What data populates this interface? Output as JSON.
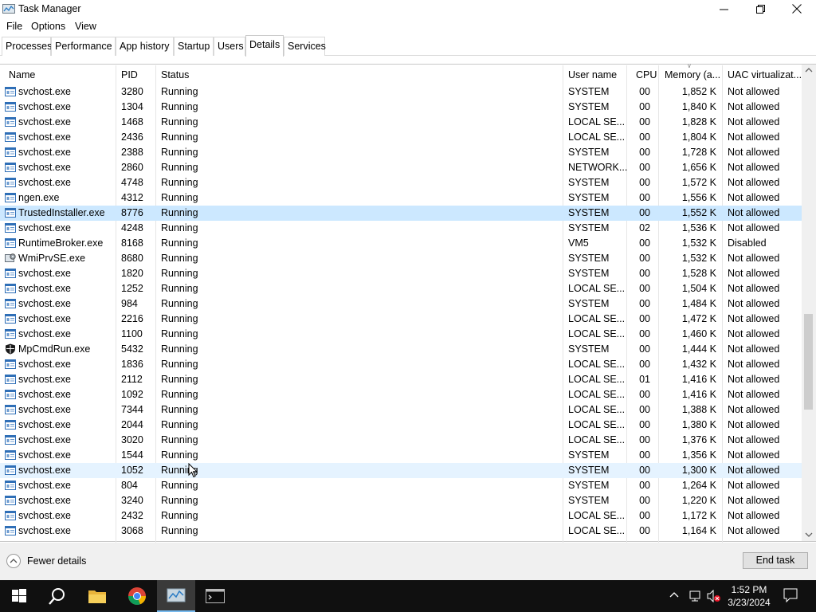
{
  "window": {
    "title": "Task Manager"
  },
  "menu": [
    "File",
    "Options",
    "View"
  ],
  "tabs": [
    "Processes",
    "Performance",
    "App history",
    "Startup",
    "Users",
    "Details",
    "Services"
  ],
  "active_tab": "Details",
  "columns": {
    "name": "Name",
    "pid": "PID",
    "status": "Status",
    "user": "User name",
    "cpu": "CPU",
    "memory": "Memory (a...",
    "uac": "UAC virtualizat..."
  },
  "processes": [
    {
      "name": "svchost.exe",
      "pid": "3280",
      "status": "Running",
      "user": "SYSTEM",
      "cpu": "00",
      "mem": "1,852 K",
      "uac": "Not allowed",
      "icon": "service-icon"
    },
    {
      "name": "svchost.exe",
      "pid": "1304",
      "status": "Running",
      "user": "SYSTEM",
      "cpu": "00",
      "mem": "1,840 K",
      "uac": "Not allowed",
      "icon": "service-icon"
    },
    {
      "name": "svchost.exe",
      "pid": "1468",
      "status": "Running",
      "user": "LOCAL SE...",
      "cpu": "00",
      "mem": "1,828 K",
      "uac": "Not allowed",
      "icon": "service-icon"
    },
    {
      "name": "svchost.exe",
      "pid": "2436",
      "status": "Running",
      "user": "LOCAL SE...",
      "cpu": "00",
      "mem": "1,804 K",
      "uac": "Not allowed",
      "icon": "service-icon"
    },
    {
      "name": "svchost.exe",
      "pid": "2388",
      "status": "Running",
      "user": "SYSTEM",
      "cpu": "00",
      "mem": "1,728 K",
      "uac": "Not allowed",
      "icon": "service-icon"
    },
    {
      "name": "svchost.exe",
      "pid": "2860",
      "status": "Running",
      "user": "NETWORK...",
      "cpu": "00",
      "mem": "1,656 K",
      "uac": "Not allowed",
      "icon": "service-icon"
    },
    {
      "name": "svchost.exe",
      "pid": "4748",
      "status": "Running",
      "user": "SYSTEM",
      "cpu": "00",
      "mem": "1,572 K",
      "uac": "Not allowed",
      "icon": "service-icon"
    },
    {
      "name": "ngen.exe",
      "pid": "4312",
      "status": "Running",
      "user": "SYSTEM",
      "cpu": "00",
      "mem": "1,556 K",
      "uac": "Not allowed",
      "icon": "service-icon"
    },
    {
      "name": "TrustedInstaller.exe",
      "pid": "8776",
      "status": "Running",
      "user": "SYSTEM",
      "cpu": "00",
      "mem": "1,552 K",
      "uac": "Not allowed",
      "icon": "service-icon",
      "selected": true
    },
    {
      "name": "svchost.exe",
      "pid": "4248",
      "status": "Running",
      "user": "SYSTEM",
      "cpu": "02",
      "mem": "1,536 K",
      "uac": "Not allowed",
      "icon": "service-icon"
    },
    {
      "name": "RuntimeBroker.exe",
      "pid": "8168",
      "status": "Running",
      "user": "VM5",
      "cpu": "00",
      "mem": "1,532 K",
      "uac": "Disabled",
      "icon": "service-icon"
    },
    {
      "name": "WmiPrvSE.exe",
      "pid": "8680",
      "status": "Running",
      "user": "SYSTEM",
      "cpu": "00",
      "mem": "1,532 K",
      "uac": "Not allowed",
      "icon": "wmi-icon"
    },
    {
      "name": "svchost.exe",
      "pid": "1820",
      "status": "Running",
      "user": "SYSTEM",
      "cpu": "00",
      "mem": "1,528 K",
      "uac": "Not allowed",
      "icon": "service-icon"
    },
    {
      "name": "svchost.exe",
      "pid": "1252",
      "status": "Running",
      "user": "LOCAL SE...",
      "cpu": "00",
      "mem": "1,504 K",
      "uac": "Not allowed",
      "icon": "service-icon"
    },
    {
      "name": "svchost.exe",
      "pid": "984",
      "status": "Running",
      "user": "SYSTEM",
      "cpu": "00",
      "mem": "1,484 K",
      "uac": "Not allowed",
      "icon": "service-icon"
    },
    {
      "name": "svchost.exe",
      "pid": "2216",
      "status": "Running",
      "user": "LOCAL SE...",
      "cpu": "00",
      "mem": "1,472 K",
      "uac": "Not allowed",
      "icon": "service-icon"
    },
    {
      "name": "svchost.exe",
      "pid": "1100",
      "status": "Running",
      "user": "LOCAL SE...",
      "cpu": "00",
      "mem": "1,460 K",
      "uac": "Not allowed",
      "icon": "service-icon"
    },
    {
      "name": "MpCmdRun.exe",
      "pid": "5432",
      "status": "Running",
      "user": "SYSTEM",
      "cpu": "00",
      "mem": "1,444 K",
      "uac": "Not allowed",
      "icon": "shield-icon"
    },
    {
      "name": "svchost.exe",
      "pid": "1836",
      "status": "Running",
      "user": "LOCAL SE...",
      "cpu": "00",
      "mem": "1,432 K",
      "uac": "Not allowed",
      "icon": "service-icon"
    },
    {
      "name": "svchost.exe",
      "pid": "2112",
      "status": "Running",
      "user": "LOCAL SE...",
      "cpu": "01",
      "mem": "1,416 K",
      "uac": "Not allowed",
      "icon": "service-icon"
    },
    {
      "name": "svchost.exe",
      "pid": "1092",
      "status": "Running",
      "user": "LOCAL SE...",
      "cpu": "00",
      "mem": "1,416 K",
      "uac": "Not allowed",
      "icon": "service-icon"
    },
    {
      "name": "svchost.exe",
      "pid": "7344",
      "status": "Running",
      "user": "LOCAL SE...",
      "cpu": "00",
      "mem": "1,388 K",
      "uac": "Not allowed",
      "icon": "service-icon"
    },
    {
      "name": "svchost.exe",
      "pid": "2044",
      "status": "Running",
      "user": "LOCAL SE...",
      "cpu": "00",
      "mem": "1,380 K",
      "uac": "Not allowed",
      "icon": "service-icon"
    },
    {
      "name": "svchost.exe",
      "pid": "3020",
      "status": "Running",
      "user": "LOCAL SE...",
      "cpu": "00",
      "mem": "1,376 K",
      "uac": "Not allowed",
      "icon": "service-icon"
    },
    {
      "name": "svchost.exe",
      "pid": "1544",
      "status": "Running",
      "user": "SYSTEM",
      "cpu": "00",
      "mem": "1,356 K",
      "uac": "Not allowed",
      "icon": "service-icon"
    },
    {
      "name": "svchost.exe",
      "pid": "1052",
      "status": "Running",
      "user": "SYSTEM",
      "cpu": "00",
      "mem": "1,300 K",
      "uac": "Not allowed",
      "icon": "service-icon",
      "hovered": true
    },
    {
      "name": "svchost.exe",
      "pid": "804",
      "status": "Running",
      "user": "SYSTEM",
      "cpu": "00",
      "mem": "1,264 K",
      "uac": "Not allowed",
      "icon": "service-icon"
    },
    {
      "name": "svchost.exe",
      "pid": "3240",
      "status": "Running",
      "user": "SYSTEM",
      "cpu": "00",
      "mem": "1,220 K",
      "uac": "Not allowed",
      "icon": "service-icon"
    },
    {
      "name": "svchost.exe",
      "pid": "2432",
      "status": "Running",
      "user": "LOCAL SE...",
      "cpu": "00",
      "mem": "1,172 K",
      "uac": "Not allowed",
      "icon": "service-icon"
    },
    {
      "name": "svchost.exe",
      "pid": "3068",
      "status": "Running",
      "user": "LOCAL SE...",
      "cpu": "00",
      "mem": "1,164 K",
      "uac": "Not allowed",
      "icon": "service-icon"
    }
  ],
  "footer": {
    "fewer_details": "Fewer details",
    "end_task": "End task"
  },
  "taskbar": {
    "apps": [
      "start-icon",
      "search-icon",
      "file-explorer-icon",
      "chrome-icon",
      "task-manager-icon",
      "terminal-icon"
    ],
    "active_app": "task-manager-icon",
    "time": "1:52 PM",
    "date": "3/23/2024"
  },
  "colors": {
    "selection": "#cce8ff",
    "hover": "#e5f3ff",
    "taskbar": "#101010",
    "accent": "#76b9ed"
  }
}
